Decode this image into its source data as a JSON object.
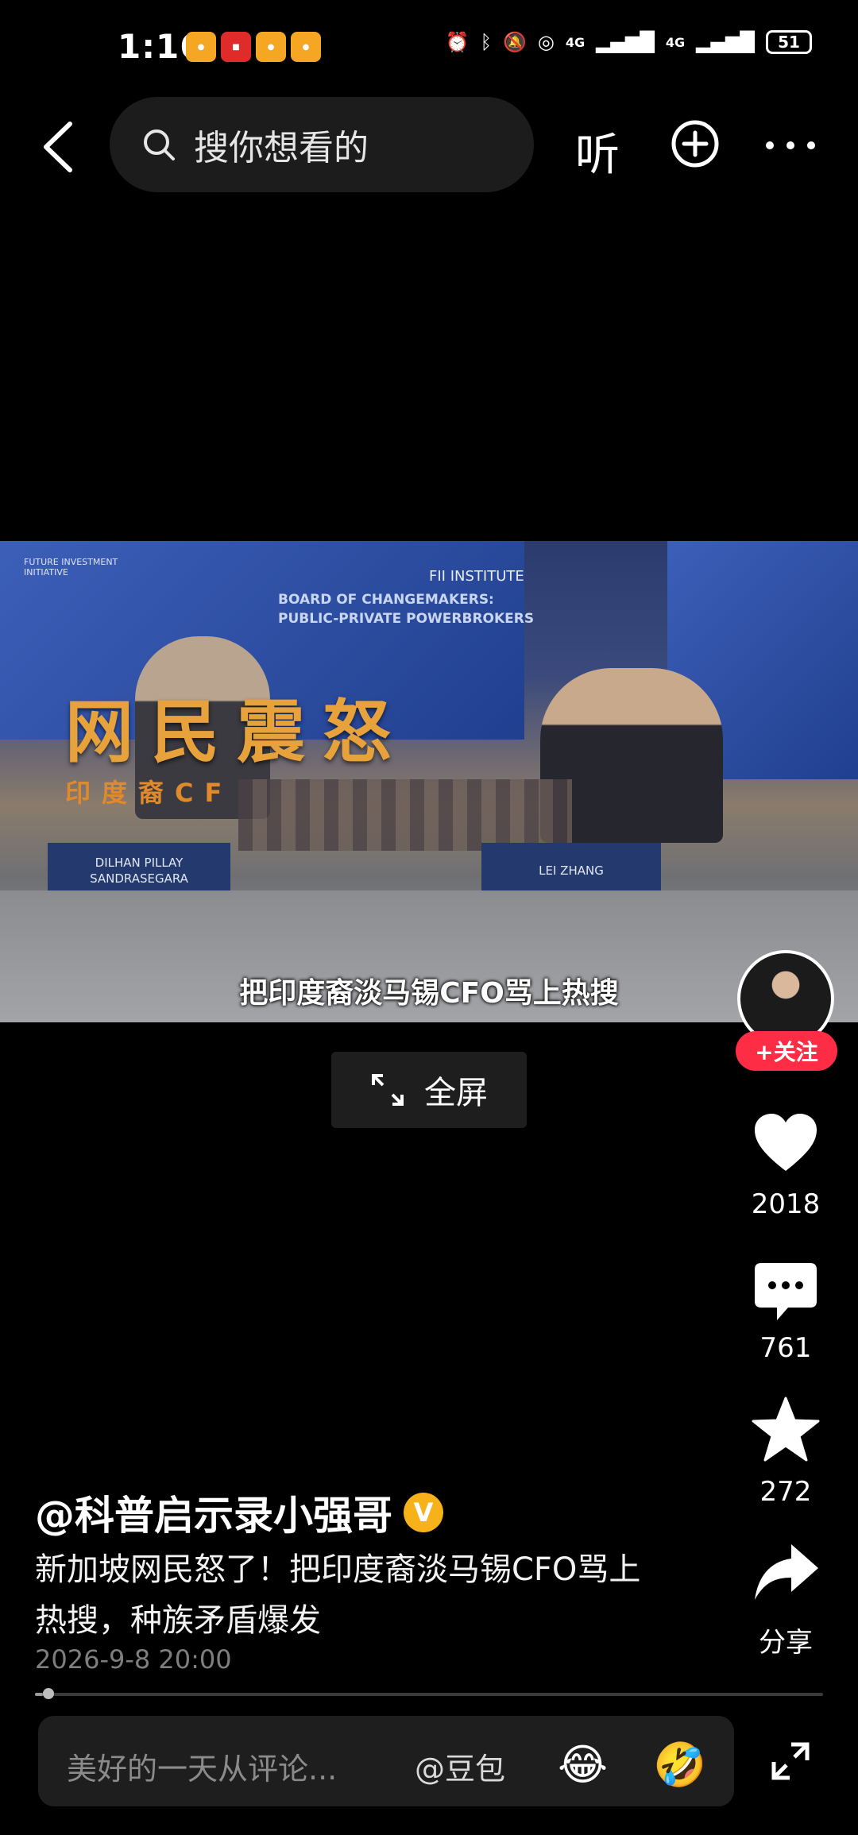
{
  "status_bar": {
    "time": "1:16",
    "battery": "51",
    "network_1": "4G",
    "network_2": "4G"
  },
  "search": {
    "placeholder": "搜你想看的"
  },
  "top_actions": {
    "listen_label": "听"
  },
  "video": {
    "overlay_title": "网民震怒",
    "overlay_subtitle": "印度裔CF",
    "subtitle": "把印度裔淡马锡CFO骂上热搜",
    "banner_text_1": "BOARD OF CHANGEMAKERS:",
    "banner_text_2": "PUBLIC-PRIVATE POWERBROKERS",
    "institute_text": "FII INSTITUTE",
    "logo_text": "FUTURE INVESTMENT INITIATIVE",
    "nameplate_left": "DILHAN PILLAY SANDRASEGARA",
    "nameplate_right": "LEI ZHANG"
  },
  "fullscreen": {
    "label": "全屏"
  },
  "rail": {
    "follow_label": "+关注",
    "likes": "2018",
    "comments": "761",
    "favorites": "272",
    "share_label": "分享"
  },
  "caption": {
    "author": "@科普启示录小强哥",
    "verified_mark": "V",
    "description": "新加坡网民怒了！把印度裔淡马锡CFO骂上热搜，种族矛盾爆发",
    "time": "2026-9-8 20:00"
  },
  "progress": {
    "fraction": 0.01
  },
  "comment_bar": {
    "placeholder": "美好的一天从评论...",
    "mention_label": "@豆包",
    "emoji_1": "😂",
    "emoji_2": "🤣"
  },
  "colors": {
    "follow": "#ff2c45",
    "verified": "#f7b21a",
    "overlay_title": "#e8a23c"
  }
}
